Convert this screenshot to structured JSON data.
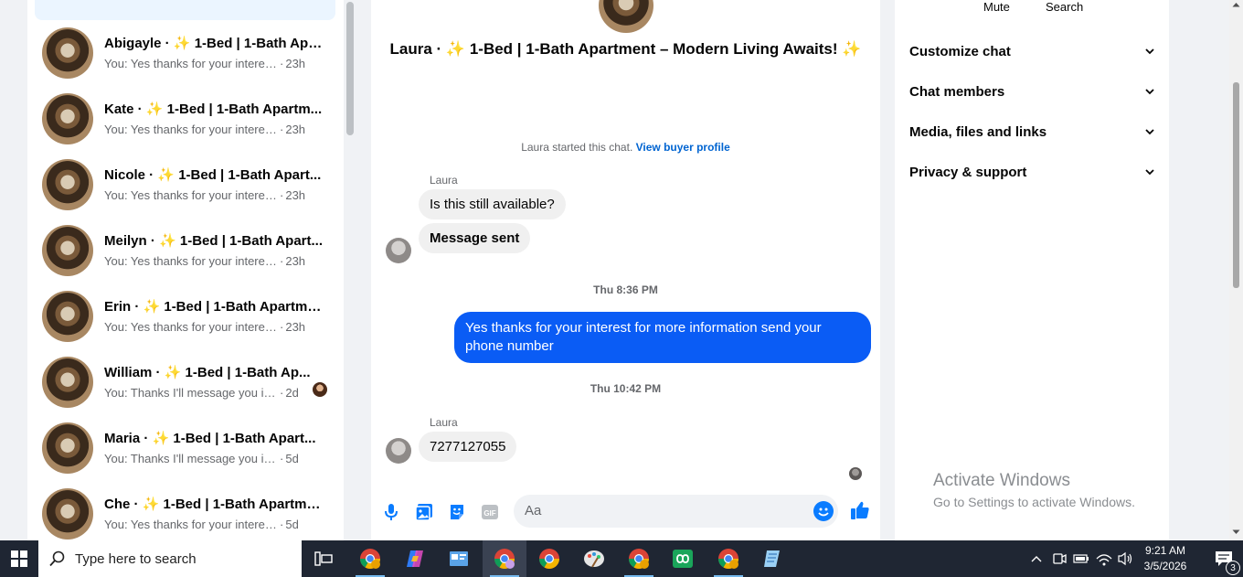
{
  "chat_list": {
    "items": [
      {
        "name": "Abigayle · ✨ 1-Bed | 1-Bath Apa...",
        "preview": "You: Yes thanks for your interest f...",
        "time": "23h",
        "seen": false
      },
      {
        "name": "Kate · ✨ 1-Bed | 1-Bath Apartm...",
        "preview": "You: Yes thanks for your interest f...",
        "time": "23h",
        "seen": false
      },
      {
        "name": "Nicole · ✨ 1-Bed | 1-Bath Apart...",
        "preview": "You: Yes thanks for your interest f...",
        "time": "23h",
        "seen": false
      },
      {
        "name": "Meilyn · ✨ 1-Bed | 1-Bath Apart...",
        "preview": "You: Yes thanks for your interest f...",
        "time": "23h",
        "seen": false
      },
      {
        "name": "Erin · ✨ 1-Bed | 1-Bath Apartme...",
        "preview": "You: Yes thanks for your interest f...",
        "time": "23h",
        "seen": false
      },
      {
        "name": "William · ✨ 1-Bed | 1-Bath Ap...",
        "preview": "You: Thanks I'll message you in ...",
        "time": "2d",
        "seen": true
      },
      {
        "name": "Maria · ✨ 1-Bed | 1-Bath Apart...",
        "preview": "You: Thanks I'll message you in a m...",
        "time": "5d",
        "seen": false
      },
      {
        "name": "Che · ✨ 1-Bed | 1-Bath Apartme...",
        "preview": "You: Yes thanks for your interest for...",
        "time": "5d",
        "seen": false
      }
    ]
  },
  "conversation": {
    "title": "Laura · ✨ 1-Bed | 1-Bath Apartment – Modern Living Awaits! ✨",
    "started_text": "Laura started this chat.",
    "view_profile": "View buyer profile",
    "sender": "Laura",
    "msg1": "Is this still available?",
    "msg2": "Message sent",
    "timestamp1": "Thu 8:36 PM",
    "outgoing": "Yes thanks for your interest for more information send your phone number",
    "timestamp2": "Thu 10:42 PM",
    "msg3": "7277127055",
    "composer_placeholder": "Aa"
  },
  "details": {
    "mute": "Mute",
    "search": "Search",
    "sections": [
      "Customize chat",
      "Chat members",
      "Media, files and links",
      "Privacy & support"
    ]
  },
  "watermark": {
    "line1": "Activate Windows",
    "line2": "Go to Settings to activate Windows."
  },
  "taskbar": {
    "search_placeholder": "Type here to search",
    "time": "9:21 AM",
    "date": "3/5/2026",
    "notification_count": "3"
  },
  "colors": {
    "accent": "#0a7cff",
    "outgoing_bubble": "#0a5cf5",
    "link": "#0064d1"
  }
}
